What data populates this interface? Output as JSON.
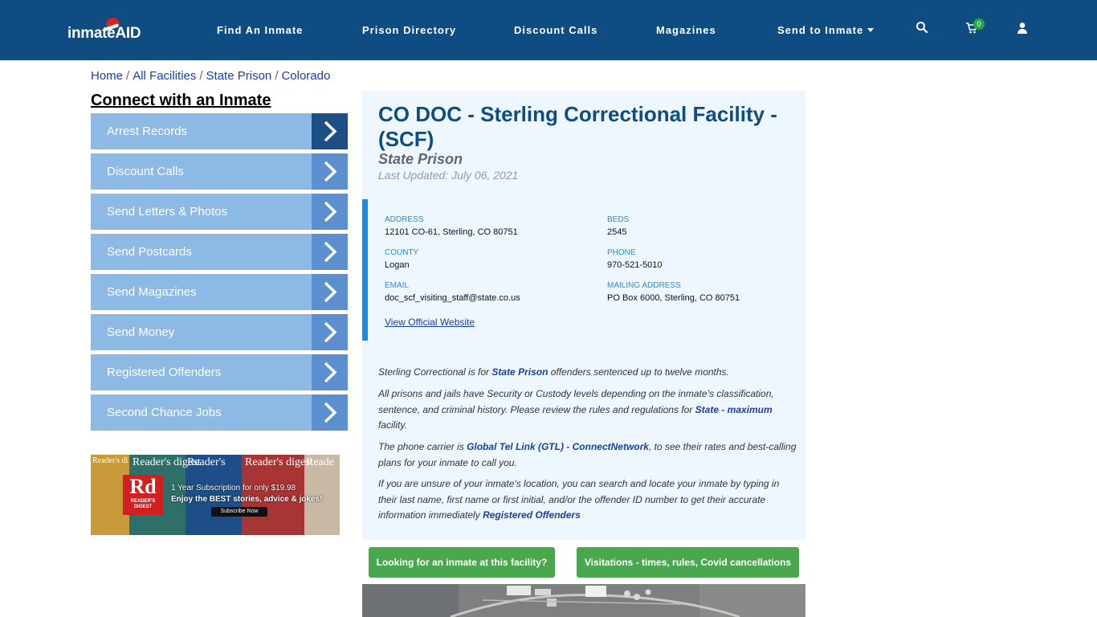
{
  "header": {
    "logo_text": "inmateAID",
    "nav": [
      "Find An Inmate",
      "Prison Directory",
      "Discount Calls",
      "Magazines",
      "Send to Inmate"
    ],
    "cart_count": "0",
    "icons": [
      "search-icon",
      "cart-icon",
      "user-icon"
    ],
    "bg_color": "#0f4c81"
  },
  "breadcrumb": [
    "Home",
    "All Facilities",
    "State Prison",
    "Colorado"
  ],
  "sidebar": {
    "title": "Connect with an Inmate",
    "items": [
      "Arrest Records",
      "Discount Calls",
      "Send Letters & Photos",
      "Send Postcards",
      "Send Magazines",
      "Send Money",
      "Registered Offenders",
      "Second Chance Jobs"
    ],
    "ad": {
      "logo": "Rd",
      "logo_sub": "READER'S DIGEST",
      "line1": "1 Year Subscription for only $19.98",
      "line2": "Enjoy the BEST stories, advice & jokes!",
      "cta": "Subscribe Now",
      "covers": [
        "Reader's digest",
        "Reader's digest",
        "Reader's",
        "Reader's digest",
        "Reade"
      ]
    }
  },
  "facility": {
    "title": "CO DOC - Sterling Correctional Facility - (SCF)",
    "type": "State Prison",
    "updated": "Last Updated: July 06, 2021",
    "fields": {
      "address": {
        "label": "ADDRESS",
        "value": "12101 CO-61, Sterling, CO 80751"
      },
      "beds": {
        "label": "BEDS",
        "value": "2545"
      },
      "county": {
        "label": "COUNTY",
        "value": "Logan"
      },
      "phone": {
        "label": "PHONE",
        "value": "970-521-5010"
      },
      "email": {
        "label": "EMAIL",
        "value": "doc_scf_visiting_staff@state.co.us"
      },
      "mailing": {
        "label": "MAILING ADDRESS",
        "value": "PO Box 6000, Sterling, CO 80751"
      }
    },
    "website_label": "View Official Website",
    "desc": {
      "p1_a": "Sterling Correctional is for ",
      "p1_link": "State Prison",
      "p1_b": " offenders sentenced up to twelve months.",
      "p2_a": "All prisons and jails have Security or Custody levels depending on the inmate’s classification, sentence, and criminal history. Please review the rules and regulations for ",
      "p2_link": "State - maximum",
      "p2_b": " facility.",
      "p3_a": "The phone carrier is ",
      "p3_link": "Global Tel Link (GTL) - ConnectNetwork",
      "p3_b": ", to see their rates and best-calling plans for your inmate to call you.",
      "p4_a": "If you are unsure of your inmate's location, you can search and locate your inmate by typing in their last name, first name or first initial, and/or the offender ID number to get their accurate information immediately ",
      "p4_link": "Registered Offenders"
    }
  },
  "buttons": {
    "looking": "Looking for an inmate at this facility?",
    "visitations": "Visitations - times, rules, Covid cancellations"
  }
}
